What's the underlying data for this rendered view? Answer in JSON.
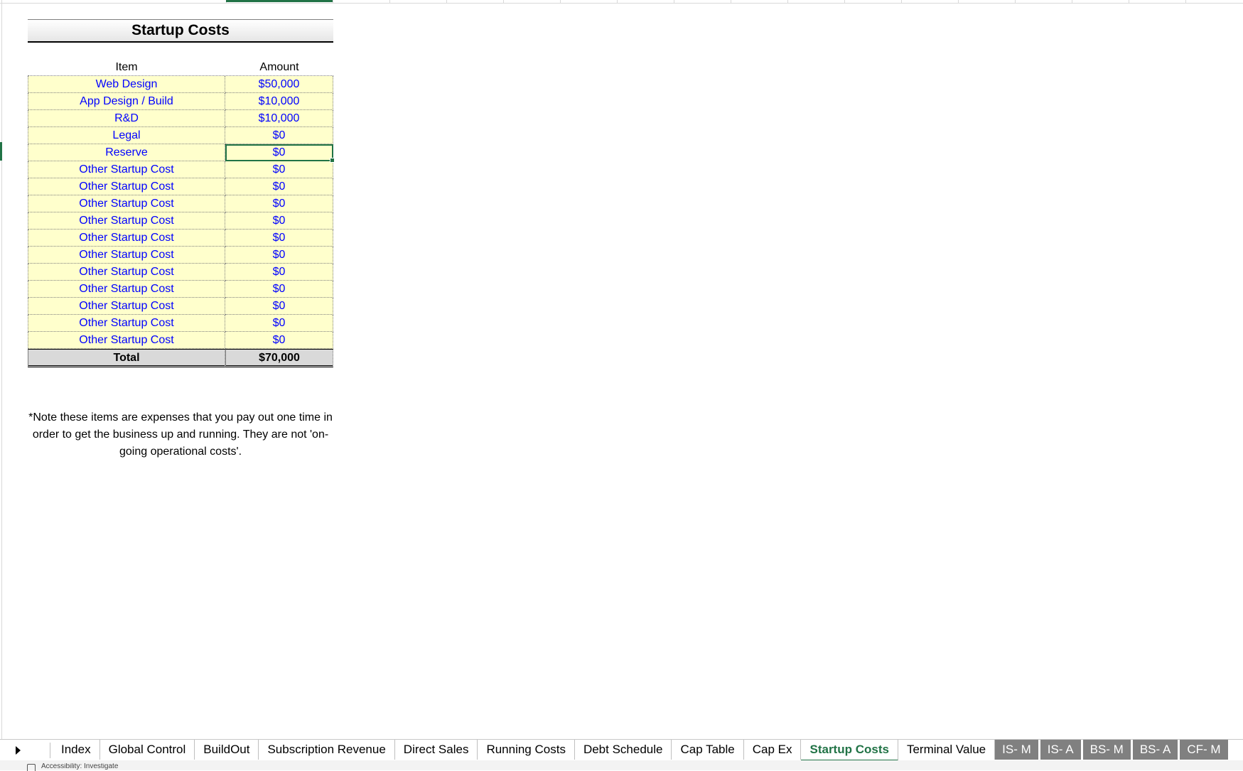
{
  "sheet": {
    "title": "Startup Costs",
    "headers": {
      "item": "Item",
      "amount": "Amount"
    },
    "rows": [
      {
        "item": "Web Design",
        "amount": "$50,000"
      },
      {
        "item": "App Design / Build",
        "amount": "$10,000"
      },
      {
        "item": "R&D",
        "amount": "$10,000"
      },
      {
        "item": "Legal",
        "amount": "$0"
      },
      {
        "item": "Reserve",
        "amount": "$0",
        "selected": true
      },
      {
        "item": "Other Startup Cost",
        "amount": "$0"
      },
      {
        "item": "Other Startup Cost",
        "amount": "$0"
      },
      {
        "item": "Other Startup Cost",
        "amount": "$0"
      },
      {
        "item": "Other Startup Cost",
        "amount": "$0"
      },
      {
        "item": "Other Startup Cost",
        "amount": "$0"
      },
      {
        "item": "Other Startup Cost",
        "amount": "$0"
      },
      {
        "item": "Other Startup Cost",
        "amount": "$0"
      },
      {
        "item": "Other Startup Cost",
        "amount": "$0"
      },
      {
        "item": "Other Startup Cost",
        "amount": "$0"
      },
      {
        "item": "Other Startup Cost",
        "amount": "$0"
      },
      {
        "item": "Other Startup Cost",
        "amount": "$0"
      }
    ],
    "total": {
      "label": "Total",
      "amount": "$70,000"
    },
    "note": "*Note these items are expenses that you pay out one time in order to get the business up and running. They are not 'on-going operational costs'."
  },
  "tabs": [
    {
      "label": "Index"
    },
    {
      "label": "Global Control"
    },
    {
      "label": "BuildOut"
    },
    {
      "label": "Subscription Revenue"
    },
    {
      "label": "Direct Sales"
    },
    {
      "label": "Running Costs"
    },
    {
      "label": "Debt Schedule"
    },
    {
      "label": "Cap Table"
    },
    {
      "label": "Cap Ex"
    },
    {
      "label": "Startup Costs",
      "active": true
    },
    {
      "label": "Terminal Value"
    },
    {
      "label": "IS- M",
      "grey": true
    },
    {
      "label": "IS- A",
      "grey": true
    },
    {
      "label": "BS- M",
      "grey": true
    },
    {
      "label": "BS- A",
      "grey": true
    },
    {
      "label": "CF- M",
      "grey": true
    }
  ],
  "status": {
    "text": "Accessibility: Investigate"
  },
  "colors": {
    "accent": "#217346",
    "input_fill": "#ffffcc",
    "input_text": "#0000ff",
    "total_fill": "#d9d9d9",
    "hidden_tab": "#808080"
  }
}
